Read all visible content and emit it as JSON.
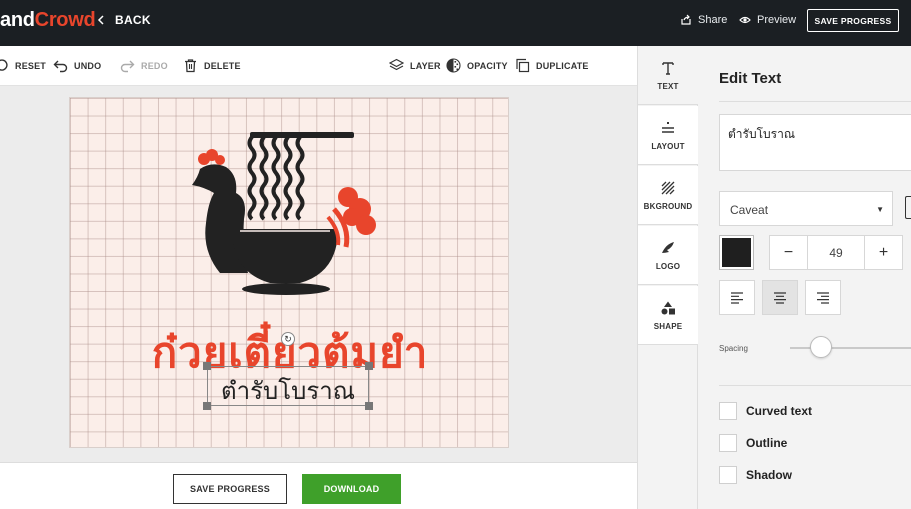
{
  "brand": {
    "part1": "and",
    "part2": "Crowd"
  },
  "topbar": {
    "back_label": "BACK",
    "share_label": "Share",
    "preview_label": "Preview",
    "save_progress_label": "SAVE PROGRESS"
  },
  "toolbar": {
    "reset_label": "RESET",
    "undo_label": "UNDO",
    "redo_label": "REDO",
    "delete_label": "DELETE",
    "layer_label": "LAYER",
    "opacity_label": "OPACITY",
    "duplicate_label": "DUPLICATE"
  },
  "canvas": {
    "headline": "ก๋วยเตี๋ยวต้มยำ",
    "subline": "ตำรับโบราณ",
    "rotate_glyph": "↻"
  },
  "bottombar": {
    "save_progress_label": "SAVE PROGRESS",
    "download_label": "DOWNLOAD"
  },
  "sidetabs": [
    {
      "label": "TEXT",
      "icon": "text-icon"
    },
    {
      "label": "LAYOUT",
      "icon": "layout-icon"
    },
    {
      "label": "BKGROUND",
      "icon": "background-icon"
    },
    {
      "label": "LOGO",
      "icon": "logo-icon"
    },
    {
      "label": "SHAPE",
      "icon": "shape-icon"
    }
  ],
  "panel": {
    "title": "Edit Text",
    "text_value": "ตำรับโบราณ",
    "font_value": "Caveat",
    "font_size": "49",
    "minus_glyph": "−",
    "plus_glyph": "+",
    "caret_glyph": "▼",
    "spacing_label": "Spacing",
    "curved_label": "Curved text",
    "outline_label": "Outline",
    "shadow_label": "Shadow"
  },
  "colors": {
    "accent": "#e8452c",
    "topbar_bg": "#1b1f23",
    "download_green": "#3fa02a",
    "text_color_swatch": "#1f1f1f",
    "canvas_bg": "#fbeee9"
  }
}
